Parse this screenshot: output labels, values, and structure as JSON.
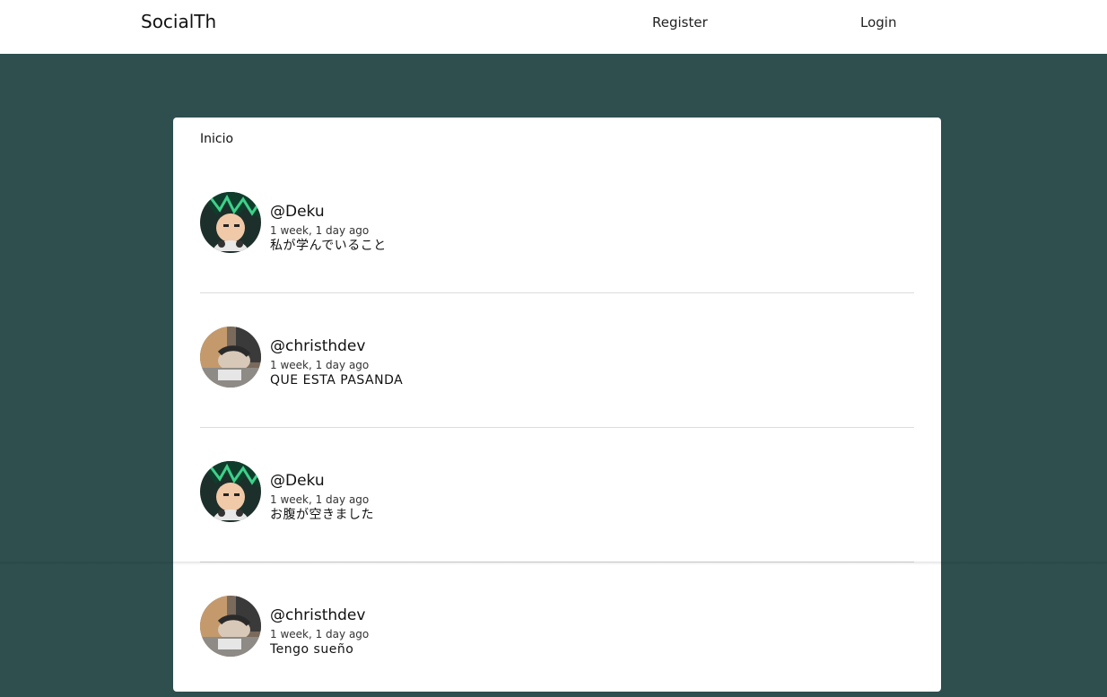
{
  "navbar": {
    "brand": "SocialTh",
    "register_label": "Register",
    "login_label": "Login"
  },
  "feed": {
    "title": "Inicio",
    "posts": [
      {
        "handle": "@Deku",
        "time": "1 week, 1 day ago",
        "content": "私が学んでいること",
        "avatar_icon": "deku-avatar"
      },
      {
        "handle": "@christhdev",
        "time": "1 week, 1 day ago",
        "content": "QUE ESTA PASANDA",
        "avatar_icon": "christhdev-avatar"
      },
      {
        "handle": "@Deku",
        "time": "1 week, 1 day ago",
        "content": "お腹が空きました",
        "avatar_icon": "deku-avatar"
      },
      {
        "handle": "@christhdev",
        "time": "1 week, 1 day ago",
        "content": "Tengo sueño",
        "avatar_icon": "christhdev-avatar"
      }
    ]
  },
  "colors": {
    "page_background": "#2f4f4f",
    "navbar_background": "#ffffff",
    "card_background": "#ffffff",
    "divider": "#dcdcdc"
  }
}
